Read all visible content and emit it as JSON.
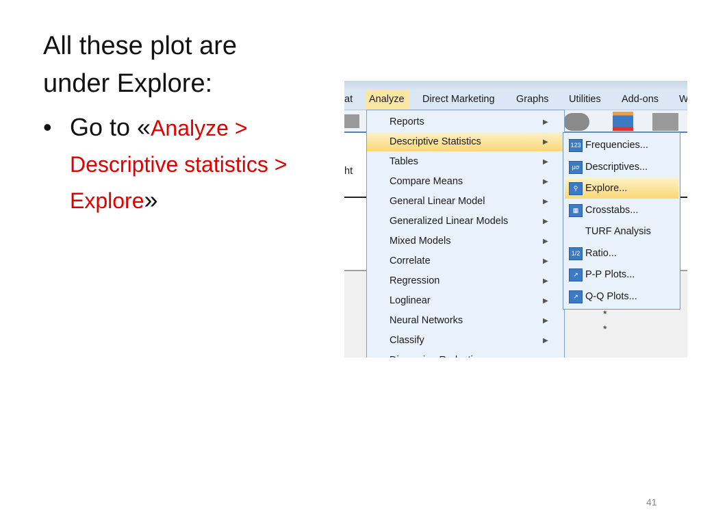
{
  "slide": {
    "title_line1": "All these plot are",
    "title_line2": "under Explore:",
    "bullet_prefix": "Go to «",
    "bullet_path1": "Analyze >",
    "bullet_path2": "Descriptive statistics >",
    "bullet_path3": "Explore",
    "bullet_suffix": "»",
    "page_number": "41"
  },
  "menubar": [
    "at",
    "Analyze",
    "Direct Marketing",
    "Graphs",
    "Utilities",
    "Add-ons",
    "W"
  ],
  "left_fragment": "ht",
  "analyze_menu": [
    "Reports",
    "Descriptive Statistics",
    "Tables",
    "Compare Means",
    "General Linear Model",
    "Generalized Linear Models",
    "Mixed Models",
    "Correlate",
    "Regression",
    "Loglinear",
    "Neural Networks",
    "Classify",
    "Dimension Reduction"
  ],
  "highlighted_menu_item": "Descriptive Statistics",
  "submenu": [
    {
      "label": "Frequencies...",
      "icon": "frequencies-123-icon",
      "glyph": "123"
    },
    {
      "label": "Descriptives...",
      "icon": "descriptives-icon",
      "glyph": "μσ"
    },
    {
      "label": "Explore...",
      "icon": "explore-icon",
      "glyph": "⚲"
    },
    {
      "label": "Crosstabs...",
      "icon": "crosstabs-icon",
      "glyph": "▦"
    },
    {
      "label": "TURF Analysis",
      "icon": "",
      "glyph": ""
    },
    {
      "label": "Ratio...",
      "icon": "ratio-icon",
      "glyph": "1/2"
    },
    {
      "label": "P-P Plots...",
      "icon": "pp-plot-icon",
      "glyph": "↗"
    },
    {
      "label": "Q-Q Plots...",
      "icon": "qq-plot-icon",
      "glyph": "↗"
    }
  ],
  "highlighted_submenu_item": "Explore...",
  "colors": {
    "highlight": "#f9d877",
    "menu_bg": "#e9f1fb",
    "accent_red": "#e00000"
  }
}
